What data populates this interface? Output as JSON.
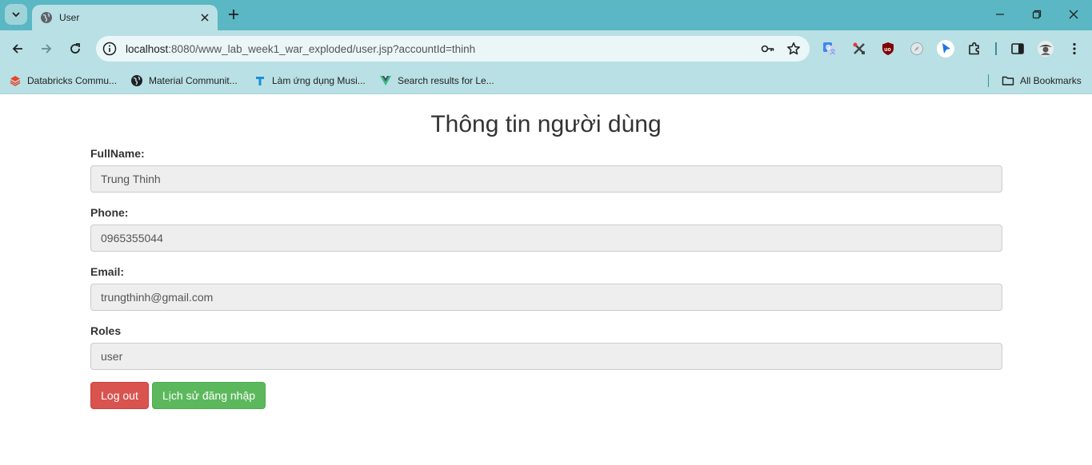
{
  "browser": {
    "tab_title": "User",
    "url_host": "localhost",
    "url_rest": ":8080/www_lab_week1_war_exploded/user.jsp?accountId=thinh",
    "bookmarks": [
      {
        "label": "Databricks Commu...",
        "icon": "databricks-icon",
        "color": "#e8452c"
      },
      {
        "label": "Material Communit...",
        "icon": "globe-icon",
        "color": "#202124"
      },
      {
        "label": "Làm ứng dụng Musi...",
        "icon": "t-logo-icon",
        "color": "#1a8fd6"
      },
      {
        "label": "Search results for Le...",
        "icon": "vue-icon",
        "color": "#41b883"
      }
    ],
    "all_bookmarks_label": "All Bookmarks",
    "accent_color": "#5ab7c3",
    "toolbar_color": "#b9e0e5"
  },
  "page": {
    "title": "Thông tin người dùng",
    "fields": {
      "fullname": {
        "label": "FullName:",
        "value": "Trung Thinh"
      },
      "phone": {
        "label": "Phone:",
        "value": "0965355044"
      },
      "email": {
        "label": "Email:",
        "value": "trungthinh@gmail.com"
      },
      "roles": {
        "label": "Roles",
        "value": "user"
      }
    },
    "buttons": {
      "logout": "Log out",
      "history": "Lịch sử đăng nhập"
    },
    "colors": {
      "danger": "#d9534f",
      "success": "#5cb85c"
    }
  }
}
